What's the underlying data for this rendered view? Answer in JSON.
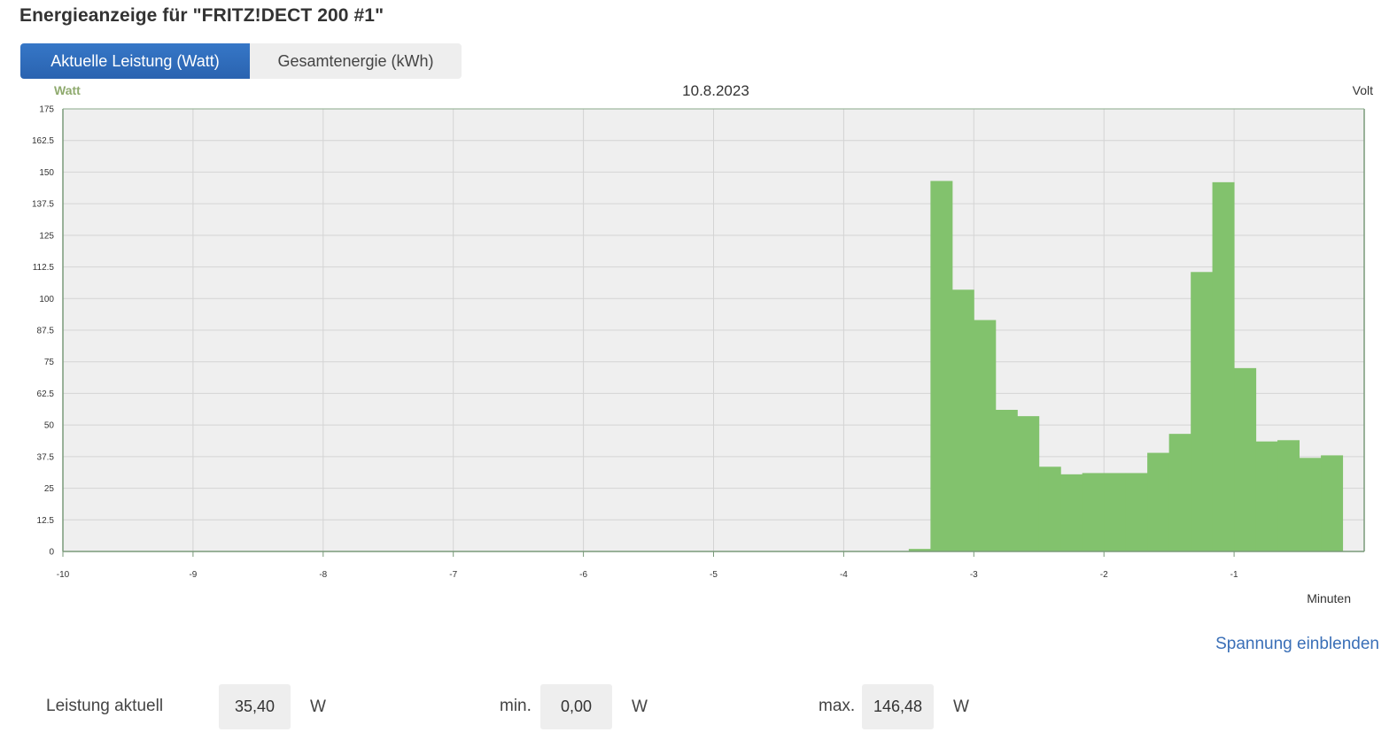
{
  "page": {
    "title": "Energieanzeige für \"FRITZ!DECT 200 #1\""
  },
  "tabs": [
    {
      "label": "Aktuelle Leistung (Watt)",
      "active": true
    },
    {
      "label": "Gesamtenergie (kWh)",
      "active": false
    }
  ],
  "colors": {
    "accent": "#2f6cbd",
    "bar": "#82c26d",
    "plot_bg": "#efefef",
    "link": "#3a6fb7"
  },
  "chart_data": {
    "type": "bar",
    "title": "10.8.2023",
    "ylabel": "Watt",
    "y2label": "Volt",
    "xlabel": "Minuten",
    "ylim": [
      0,
      175
    ],
    "xlim": [
      -10,
      0
    ],
    "yticks": [
      "0",
      "12.5",
      "25",
      "37.5",
      "50",
      "62.5",
      "75",
      "87.5",
      "100",
      "112.5",
      "125",
      "137.5",
      "150",
      "162.5",
      "175"
    ],
    "xticks": [
      "-10",
      "-9",
      "-8",
      "-7",
      "-6",
      "-5",
      "-4",
      "-3",
      "-2",
      "-1"
    ],
    "grid": true,
    "bar_width_minutes": 0.1667,
    "x": [
      -3.5,
      -3.333,
      -3.167,
      -3.0,
      -2.833,
      -2.667,
      -2.5,
      -2.333,
      -2.167,
      -2.0,
      -1.833,
      -1.667,
      -1.5,
      -1.333,
      -1.167,
      -1.0,
      -0.833,
      -0.667,
      -0.5,
      -0.333,
      -0.167
    ],
    "values": [
      1,
      146.5,
      103.5,
      91.5,
      56,
      53.5,
      33.5,
      30.5,
      31,
      31,
      31,
      39,
      46.5,
      110.5,
      146,
      72.5,
      43.5,
      44,
      37,
      38
    ]
  },
  "voltage_link": "Spannung einblenden",
  "stats": {
    "label": "Leistung aktuell",
    "current": "35,40",
    "min_label": "min.",
    "min": "0,00",
    "max_label": "max.",
    "max": "146,48",
    "unit": "W"
  }
}
